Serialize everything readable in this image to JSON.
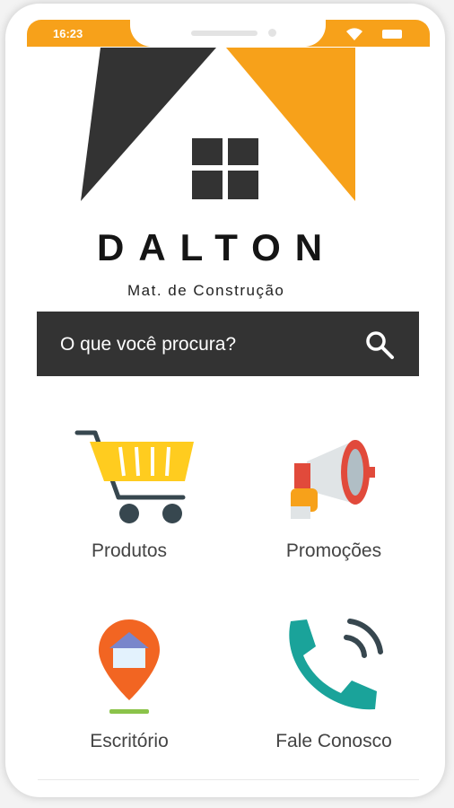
{
  "status": {
    "time": "16:23",
    "bar_color": "#f7a11a"
  },
  "logo": {
    "name": "DALTON",
    "tagline": "Mat. de Construção",
    "colors": {
      "orange": "#f7a11a",
      "dark": "#333333"
    }
  },
  "search": {
    "placeholder": "O que você procura?",
    "icon": "search-icon"
  },
  "menu": [
    {
      "label": "Produtos",
      "icon": "shopping-cart-icon"
    },
    {
      "label": "Promoções",
      "icon": "megaphone-icon"
    },
    {
      "label": "Escritório",
      "icon": "location-pin-icon"
    },
    {
      "label": "Fale Conosco",
      "icon": "phone-icon"
    }
  ]
}
